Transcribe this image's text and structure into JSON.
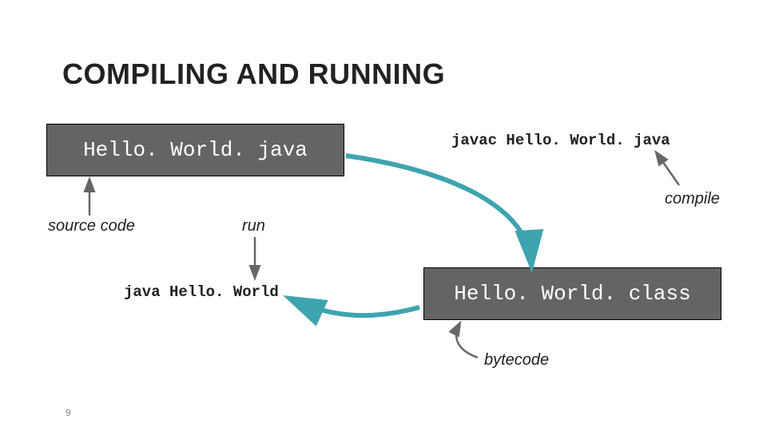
{
  "title": "COMPILING AND RUNNING",
  "boxes": {
    "source_file": "Hello. World. java",
    "class_file": "Hello. World. class"
  },
  "commands": {
    "compile": "javac Hello. World. java",
    "run": "java Hello. World"
  },
  "labels": {
    "source_code": "source code",
    "run": "run",
    "compile": "compile",
    "bytecode": "bytecode"
  },
  "page_number": "9",
  "colors": {
    "box_bg": "#646464",
    "arrow_teal": "#3ea4af",
    "arrow_grey": "#666666"
  }
}
